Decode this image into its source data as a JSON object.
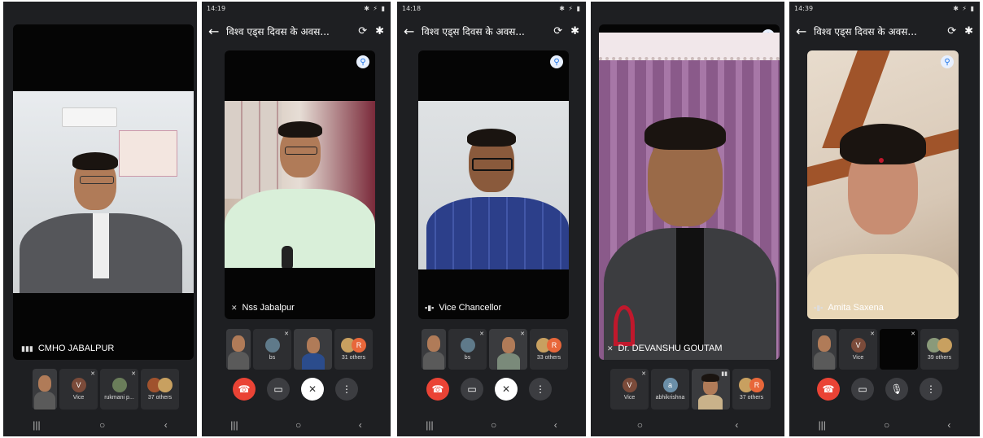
{
  "panels": [
    {
      "name_label": "CMHO JABALPUR",
      "thumbs": [
        {
          "type": "face",
          "label": ""
        },
        {
          "type": "avatar",
          "letter": "V",
          "label": "Vice",
          "color": "#7b4b3a"
        },
        {
          "type": "avatar",
          "letter": "",
          "label": "rukmani p...",
          "color": "#6a7d5a"
        },
        {
          "type": "group",
          "label": "37 others"
        }
      ]
    },
    {
      "status_time": "14:19",
      "meeting_title": "विश्व एड्स दिवस के अवस...",
      "name_label": "Nss Jabalpur",
      "thumbs": [
        {
          "type": "face",
          "label": ""
        },
        {
          "type": "avatar",
          "letter": "",
          "label": "bs",
          "color": "#5f7a8a"
        },
        {
          "type": "face",
          "label": ""
        },
        {
          "type": "group",
          "label": "31 others"
        }
      ]
    },
    {
      "status_time": "14:18",
      "meeting_title": "विश्व एड्स दिवस के अवस...",
      "name_label": "Vice Chancellor",
      "thumbs": [
        {
          "type": "face",
          "label": ""
        },
        {
          "type": "avatar",
          "letter": "",
          "label": "bs",
          "color": "#5f7a8a"
        },
        {
          "type": "face",
          "label": ""
        },
        {
          "type": "group",
          "label": "33 others"
        }
      ]
    },
    {
      "name_label": "Dr. DEVANSHU GOUTAM",
      "thumbs": [
        {
          "type": "avatar",
          "letter": "V",
          "label": "Vice",
          "color": "#7b4b3a"
        },
        {
          "type": "avatar",
          "letter": "a",
          "label": "abhikrishna",
          "color": "#6b8fa8"
        },
        {
          "type": "face",
          "label": ""
        },
        {
          "type": "group",
          "label": "37 others"
        }
      ]
    },
    {
      "status_time": "14:39",
      "meeting_title": "विश्व एड्स दिवस के अवस...",
      "name_label": "Amita Saxena",
      "thumbs": [
        {
          "type": "face",
          "label": ""
        },
        {
          "type": "avatar",
          "letter": "V",
          "label": "Vice",
          "color": "#7b4b3a"
        },
        {
          "type": "blank",
          "label": ""
        },
        {
          "type": "group",
          "label": "39 others"
        }
      ]
    }
  ],
  "group_letter": "R",
  "colors": {
    "end_call": "#ea4335",
    "pin": "#1a73e8",
    "background": "#1e1f22"
  }
}
